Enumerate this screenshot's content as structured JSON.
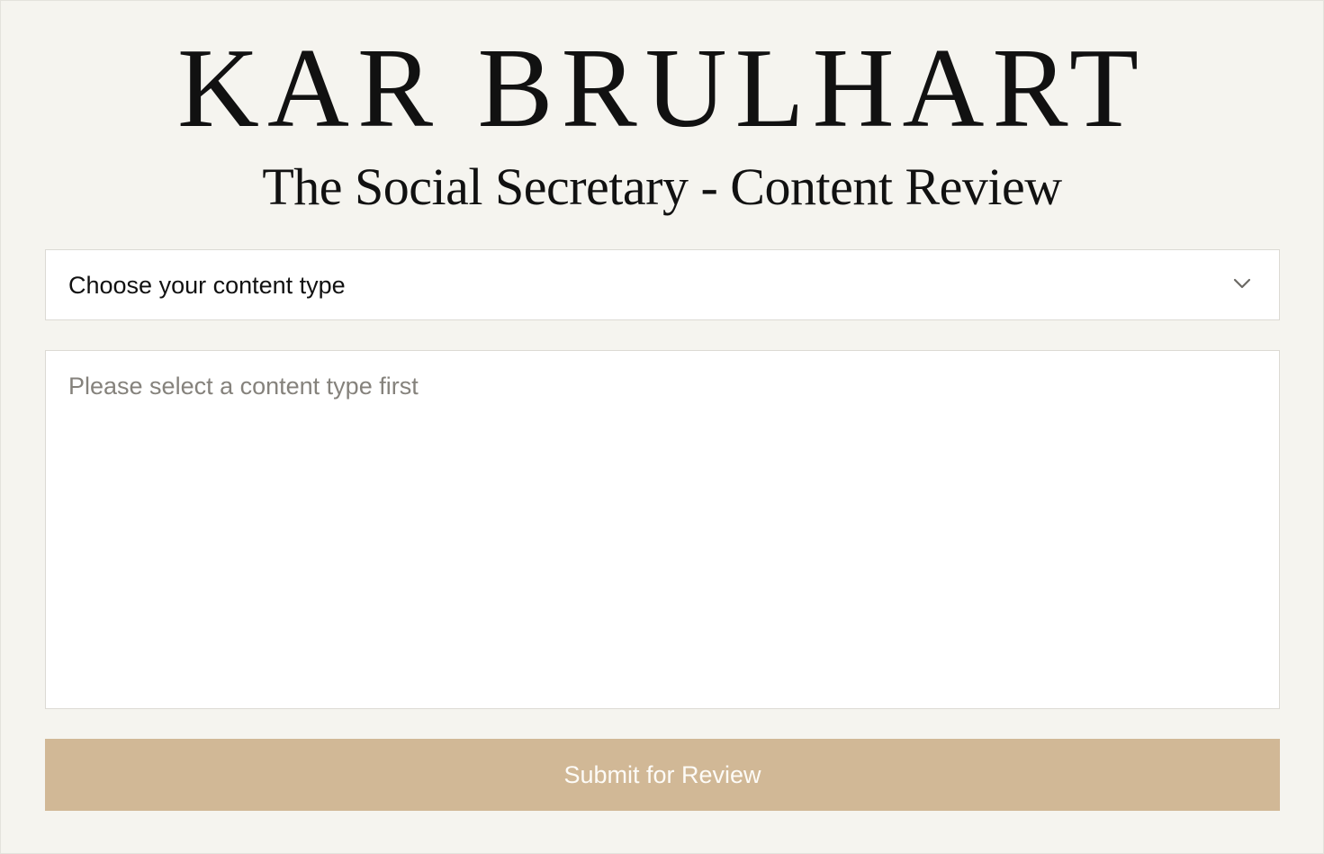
{
  "brand": {
    "name": "KAR BRULHART"
  },
  "page": {
    "title": "The Social Secretary - Content Review"
  },
  "content_type_select": {
    "selected_label": "Choose your content type",
    "icon": "chevron-down-icon"
  },
  "content_input": {
    "placeholder": "Please select a content type first",
    "value": ""
  },
  "submit_button": {
    "label": "Submit for Review",
    "enabled": false
  },
  "colors": {
    "page_background": "#f5f4ef",
    "accent_button": "#d1b896",
    "button_text": "#fdfbf7",
    "text_primary": "#111111",
    "placeholder_text": "#85827c"
  }
}
